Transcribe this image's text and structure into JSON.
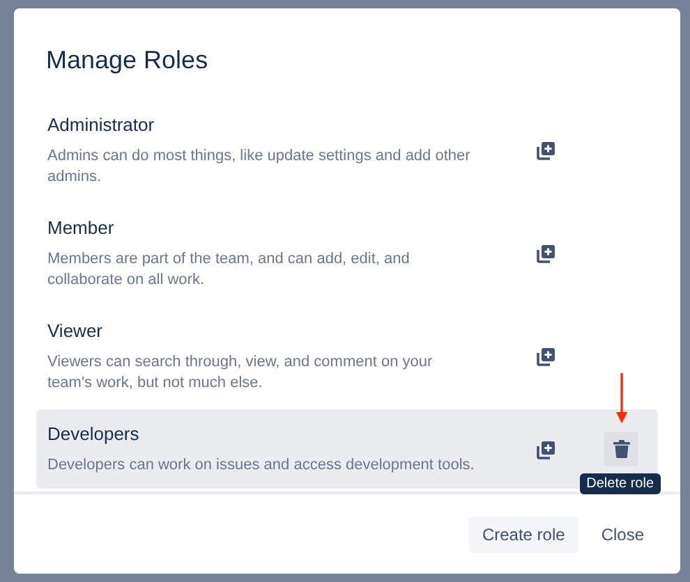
{
  "dialog": {
    "title": "Manage Roles"
  },
  "roles": [
    {
      "name": "Administrator",
      "description": "Admins can do most things, like update settings and add other admins.",
      "hovered": false
    },
    {
      "name": "Member",
      "description": "Members are part of the team, and can add, edit, and collaborate on all work.",
      "hovered": false
    },
    {
      "name": "Viewer",
      "description": "Viewers can search through, view, and comment on your team's work, but not much else.",
      "hovered": false
    },
    {
      "name": "Developers",
      "description": "Developers can work on issues and access development tools.",
      "hovered": true
    }
  ],
  "delete_tooltip": "Delete role",
  "buttons": [
    {
      "label": "Create role",
      "kind": "secondary"
    },
    {
      "label": "Close",
      "kind": "subtle"
    }
  ]
}
